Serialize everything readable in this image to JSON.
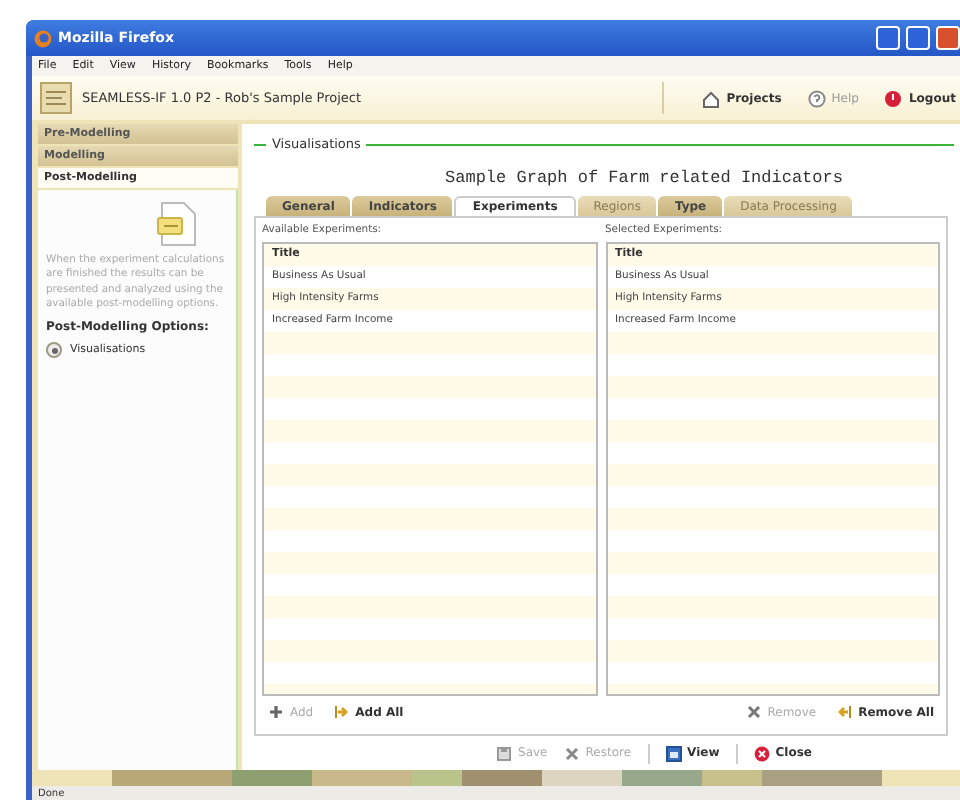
{
  "window": {
    "title": "Mozilla Firefox"
  },
  "menu": [
    "File",
    "Edit",
    "View",
    "History",
    "Bookmarks",
    "Tools",
    "Help"
  ],
  "header": {
    "title": "SEAMLESS-IF 1.0 P2 - Rob's Sample Project",
    "links": [
      {
        "label": "Projects",
        "kind": "home",
        "disabled": false
      },
      {
        "label": "Help",
        "kind": "help",
        "disabled": true
      },
      {
        "label": "Logout",
        "kind": "logout",
        "disabled": false
      }
    ]
  },
  "sidebar": {
    "items": [
      {
        "label": "Pre-Modelling",
        "selected": false
      },
      {
        "label": "Modelling",
        "selected": false
      },
      {
        "label": "Post-Modelling",
        "selected": true
      }
    ],
    "description": "When the experiment calculations are finished the results can be presented and analyzed using the available post-modelling options.",
    "options_title": "Post-Modelling Options:",
    "options": [
      {
        "label": "Visualisations",
        "selected": true
      }
    ]
  },
  "panel": {
    "legend": "Visualisations",
    "title": "Sample Graph of Farm related Indicators",
    "tabs": [
      {
        "label": "General",
        "selected": false,
        "disabled": false
      },
      {
        "label": "Indicators",
        "selected": false,
        "disabled": false
      },
      {
        "label": "Experiments",
        "selected": true,
        "disabled": false
      },
      {
        "label": "Regions",
        "selected": false,
        "disabled": true
      },
      {
        "label": "Type",
        "selected": false,
        "disabled": false
      },
      {
        "label": "Data Processing",
        "selected": false,
        "disabled": true
      }
    ],
    "lists": [
      {
        "label": "Available Experiments:",
        "column": "Title",
        "rows": [
          "Business As Usual",
          "High Intensity Farms",
          "Increased Farm Income"
        ]
      },
      {
        "label": "Selected Experiments:",
        "column": "Title",
        "rows": [
          "Business As Usual",
          "High Intensity Farms",
          "Increased Farm Income"
        ]
      }
    ],
    "list_actions": [
      {
        "label": "Add",
        "kind": "add",
        "disabled": true
      },
      {
        "label": "Add All",
        "kind": "add_all",
        "disabled": false
      },
      {
        "label": "Remove",
        "kind": "remove",
        "disabled": true
      },
      {
        "label": "Remove All",
        "kind": "remove_all",
        "disabled": false
      }
    ],
    "buttons": [
      {
        "label": "Save",
        "kind": "save",
        "disabled": true
      },
      {
        "label": "Restore",
        "kind": "restore",
        "disabled": true
      },
      {
        "label": "View",
        "kind": "view",
        "disabled": false
      },
      {
        "label": "Close",
        "kind": "close",
        "disabled": false
      }
    ]
  },
  "status_bar": "Done"
}
